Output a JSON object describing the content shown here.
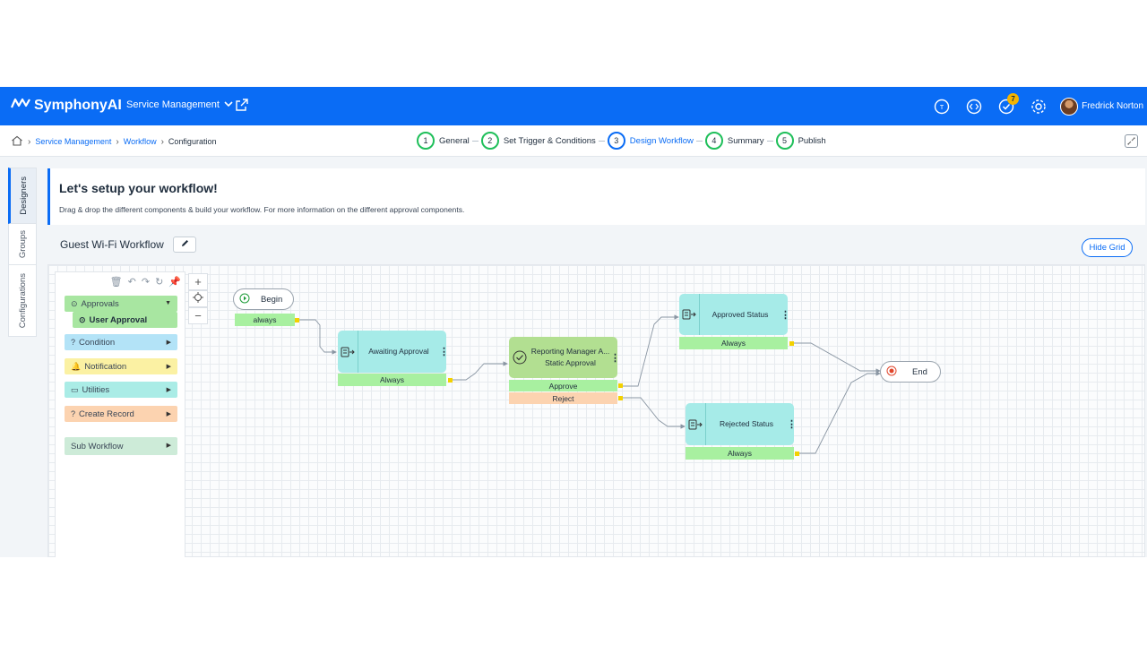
{
  "topbar": {
    "brand": "SymphonyAI",
    "module": "Service Management",
    "notification_count": "7",
    "user_name": "Fredrick Norton",
    "accent": "#0a6cf5"
  },
  "breadcrumb": {
    "items": [
      "Service Management",
      "Workflow",
      "Configuration"
    ]
  },
  "steps": [
    {
      "num": "1",
      "label": "General"
    },
    {
      "num": "2",
      "label": "Set Trigger & Conditions"
    },
    {
      "num": "3",
      "label": "Design Workflow"
    },
    {
      "num": "4",
      "label": "Summary"
    },
    {
      "num": "5",
      "label": "Publish"
    }
  ],
  "side_tabs": [
    "Designers",
    "Groups",
    "Configurations"
  ],
  "setup": {
    "title": "Let's setup your workflow!",
    "description": "Drag & drop the different components & build your workflow. For more information on the different approval components."
  },
  "workflow_name": "Guest Wi-Fi Workflow",
  "hide_grid_label": "Hide Grid",
  "palette": {
    "approvals": "Approvals",
    "user_approval": "User Approval",
    "condition": "Condition",
    "notification": "Notification",
    "utilities": "Utilities",
    "create_record": "Create Record",
    "sub_workflow": "Sub Workflow"
  },
  "diagram": {
    "begin": "Begin",
    "begin_condition": "always",
    "awaiting": "Awaiting Approval",
    "awaiting_condition": "Always",
    "manager_line1": "Reporting Manager A...",
    "manager_line2": "Static Approval",
    "approve": "Approve",
    "reject": "Reject",
    "approved_status": "Approved Status",
    "approved_condition": "Always",
    "rejected_status": "Rejected Status",
    "rejected_condition": "Always",
    "end": "End"
  }
}
